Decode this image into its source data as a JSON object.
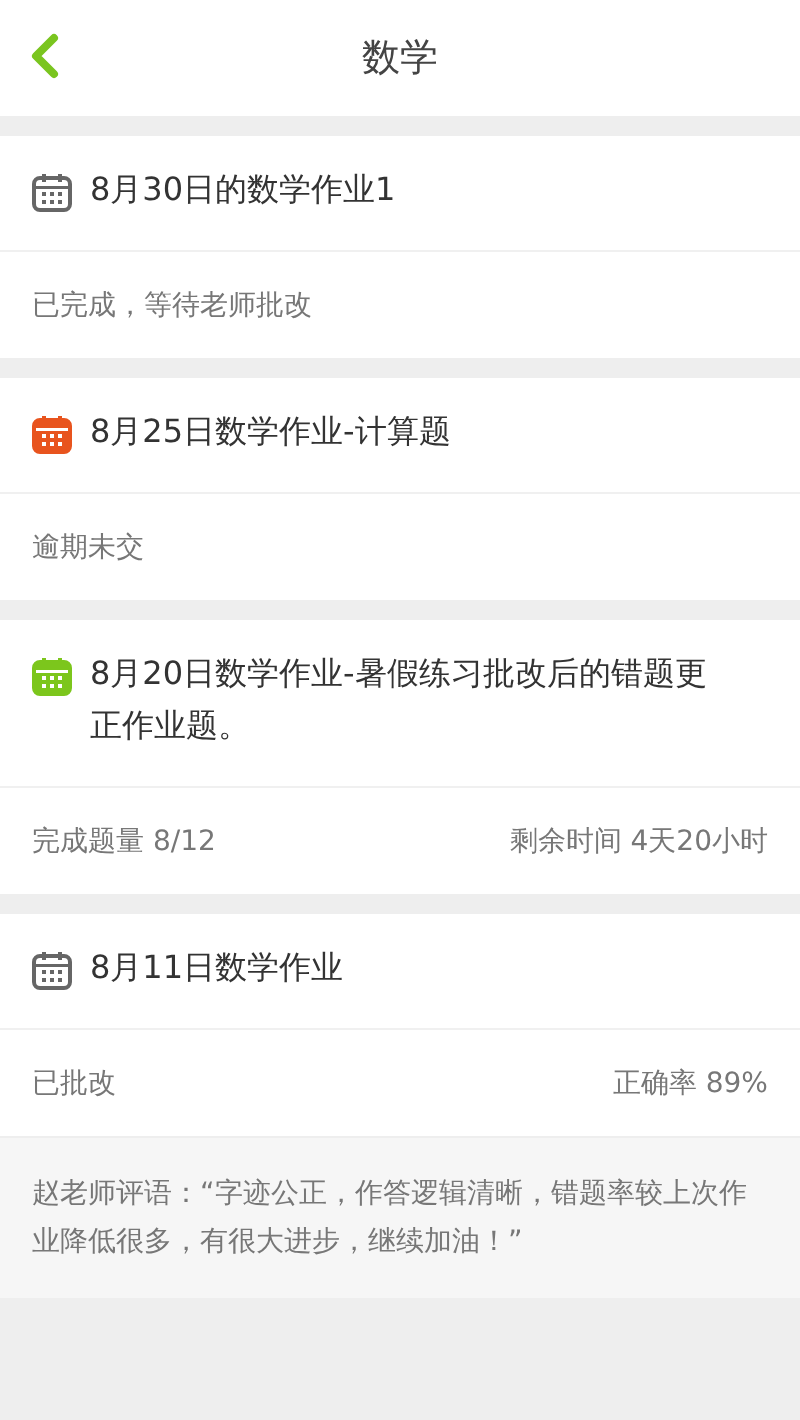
{
  "header": {
    "title": "数学"
  },
  "assignments": [
    {
      "title": "8月30日的数学作业1",
      "color": "#666666",
      "status": "已完成，等待老师批改"
    },
    {
      "title": "8月25日数学作业-计算题",
      "color": "#e8541e",
      "status": "逾期未交"
    },
    {
      "title": "8月20日数学作业-暑假练习批改后的错题更正作业题。",
      "color": "#7cc61c",
      "status": "完成题量 8/12",
      "detail": "剩余时间 4天20小时"
    },
    {
      "title": "8月11日数学作业",
      "color": "#666666",
      "status": "已批改",
      "detail": "正确率 89%",
      "comment": "赵老师评语：“字迹公正，作答逻辑清晰，错题率较上次作业降低很多，有很大进步，继续加油！”"
    }
  ]
}
